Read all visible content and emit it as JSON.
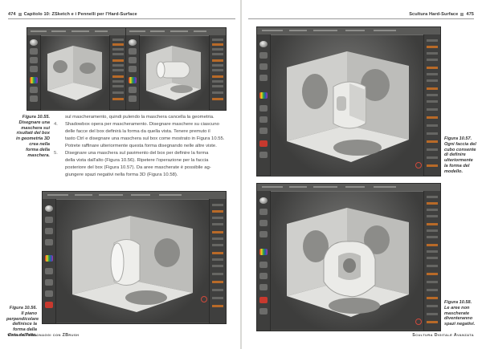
{
  "left_page": {
    "header_number": "474",
    "header_title": "Capitolo 10: ZSketch e i Pennelli per l'Hard-Surface",
    "caption_1055": "Figura 10.55. Disegnare una maschera sui risultati del box in geometria 3D crea nella forma della maschera.",
    "caption_1056": "Figura 10.56. Il piano perpendicolare definisce la forma dalla vista dall'alto.",
    "body_lines": [
      {
        "num": "",
        "text": "sul mascheramento, quindi pulendo la maschera cancella la geometria."
      },
      {
        "num": "4.",
        "text": "Shadowbox opera per mascheramento. Disegnare maschere su ciascuno"
      },
      {
        "num": "",
        "text": "delle facce del box definirà la forma da quella vista. Tenere premuto il"
      },
      {
        "num": "",
        "text": "tasto Ctrl e disegnare una maschera sul box come mostrato in Figura 10.55."
      },
      {
        "num": "",
        "text": "Potrete raffinare ulteriormente questa forma disegnando nelle altre viste."
      },
      {
        "num": "5.",
        "text": "Disegnare una maschera sul pavimento del box per definire la forma"
      },
      {
        "num": "",
        "text": "della vista dall'alto (Figura 10.56). Ripetere l'operazione per la faccia"
      },
      {
        "num": "",
        "text": "posteriore del box (Figura 10.57). Da aree mascherate è possibile ag-"
      },
      {
        "num": "",
        "text": "giungere spazi negativi nella forma 3D (Figura 10.58)."
      }
    ],
    "footer": "Creare Personaggi con ZBrush"
  },
  "right_page": {
    "header_title": "Scultura Hard-Surface",
    "header_number": "475",
    "caption_1057": "Figura 10.57. Ogni faccia del cubo consente di definire ulteriormente la forma del modello.",
    "caption_1058": "Figura 10.58. Le aree non mascherate diventeranno spazi negativi.",
    "footer": "Scultura Digitale Avanzata"
  },
  "colors": {
    "ui_dark": "#4a4a48",
    "ui_panel": "#3e3e3d",
    "accent_orange": "#b86a28",
    "accent_red": "#c8392e",
    "model_light": "#d7d7d4",
    "text": "#333333"
  }
}
